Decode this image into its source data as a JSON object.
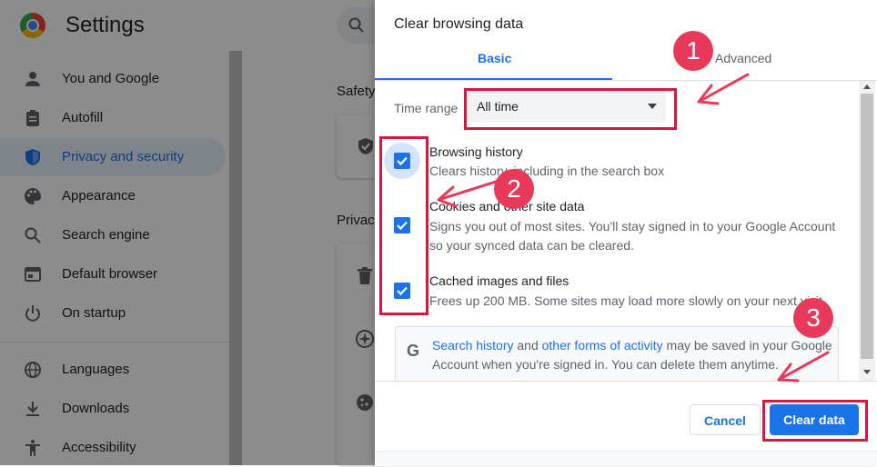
{
  "app": {
    "title": "Settings",
    "icon": "chrome-logo"
  },
  "sidebar": {
    "items": [
      {
        "label": "You and Google",
        "icon": "person-icon"
      },
      {
        "label": "Autofill",
        "icon": "clipboard-icon"
      },
      {
        "label": "Privacy and security",
        "icon": "shield-icon",
        "active": true
      },
      {
        "label": "Appearance",
        "icon": "palette-icon"
      },
      {
        "label": "Search engine",
        "icon": "search-icon"
      },
      {
        "label": "Default browser",
        "icon": "browser-window-icon"
      },
      {
        "label": "On startup",
        "icon": "power-icon"
      },
      {
        "label": "Languages",
        "icon": "globe-icon"
      },
      {
        "label": "Downloads",
        "icon": "download-icon"
      },
      {
        "label": "Accessibility",
        "icon": "accessibility-icon"
      }
    ]
  },
  "main": {
    "section_safety": "Safety",
    "section_privacy": "Privac"
  },
  "dialog": {
    "title": "Clear browsing data",
    "tabs": [
      {
        "label": "Basic",
        "selected": true
      },
      {
        "label": "Advanced",
        "selected": false
      }
    ],
    "time_range_label": "Time range",
    "time_range_value": "All time",
    "options": [
      {
        "title": "Browsing history",
        "description": "Clears history, including in the search box",
        "checked": true
      },
      {
        "title": "Cookies and other site data",
        "description": "Signs you out of most sites. You'll stay signed in to your Google Account so your synced data can be cleared.",
        "checked": true
      },
      {
        "title": "Cached images and files",
        "description": "Frees up 200 MB. Some sites may load more slowly on your next visit.",
        "checked": true
      }
    ],
    "info": {
      "link1": "Search history",
      "text1": " and ",
      "link2": "other forms of activity",
      "text2": " may be saved in your Google Account when you're signed in. You can delete them anytime."
    },
    "cancel_label": "Cancel",
    "clear_label": "Clear data"
  },
  "annotations": {
    "step1": "1",
    "step2": "2",
    "step3": "3",
    "color": "#d6173f"
  },
  "colors": {
    "accent": "#1a73e8",
    "annotation": "#d6173f"
  }
}
